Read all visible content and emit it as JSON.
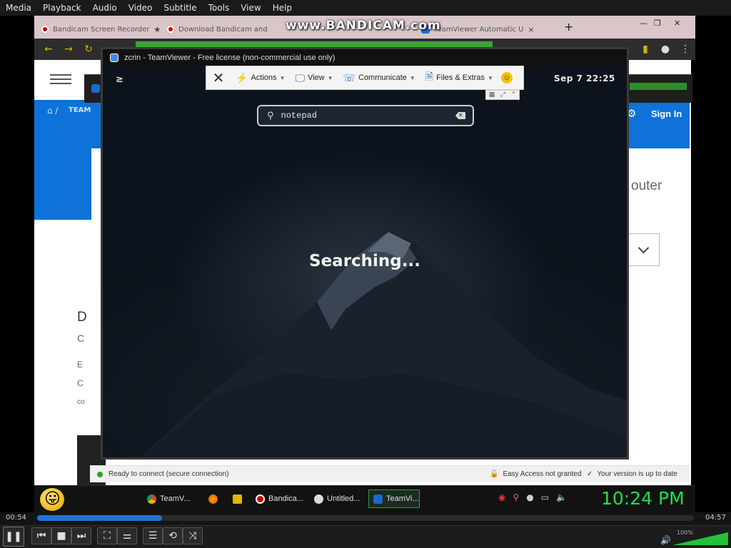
{
  "vlc": {
    "menu": [
      "Media",
      "Playback",
      "Audio",
      "Video",
      "Subtitle",
      "Tools",
      "View",
      "Help"
    ],
    "time_elapsed": "00:54",
    "time_total": "04:57",
    "volume_label": "100%",
    "progress_fraction": 0.19,
    "volume_fraction": 1.0
  },
  "browser": {
    "tabs": [
      {
        "label": "Bandicam Screen Recorder",
        "icon": "bandicam-record-icon"
      },
      {
        "label": "Download Bandicam and",
        "icon": "bandicam-record-icon"
      },
      {
        "label": "TeamViewer Automatic U",
        "icon": "teamviewer-icon"
      }
    ],
    "watermark": "www.BANDICAM.com",
    "page": {
      "breadcrumb_short": "TEAM",
      "sign_in": "Sign In",
      "right_fragment": "outer",
      "left_fragments": [
        "D",
        "C",
        "E",
        "C",
        "co"
      ]
    }
  },
  "teamviewer_bg": {
    "status_text": "Ready to connect (secure connection)",
    "easy_access": "Easy Access not granted",
    "version_status": "Your version is up to date"
  },
  "teamviewer": {
    "title": "zcrin - TeamViewer - Free license (non-commercial use only)",
    "toolbar": {
      "actions": "Actions",
      "view": "View",
      "communicate": "Communicate",
      "files": "Files & Extras"
    },
    "remote": {
      "datetime": "Sep 7  22:25",
      "search_value": "notepad",
      "searching_text": "Searching..."
    }
  },
  "taskbar": {
    "tasks": [
      {
        "label": "TeamV...",
        "icon": "chrome-icon"
      },
      {
        "label": "",
        "icon": "firefox-icon"
      },
      {
        "label": "",
        "icon": "folder-icon"
      },
      {
        "label": "Bandica...",
        "icon": "bandicam-icon"
      },
      {
        "label": "Untitled...",
        "icon": "paint-icon"
      },
      {
        "label": "TeamVi...",
        "icon": "teamviewer-icon"
      }
    ],
    "clock": "10:24 PM"
  }
}
